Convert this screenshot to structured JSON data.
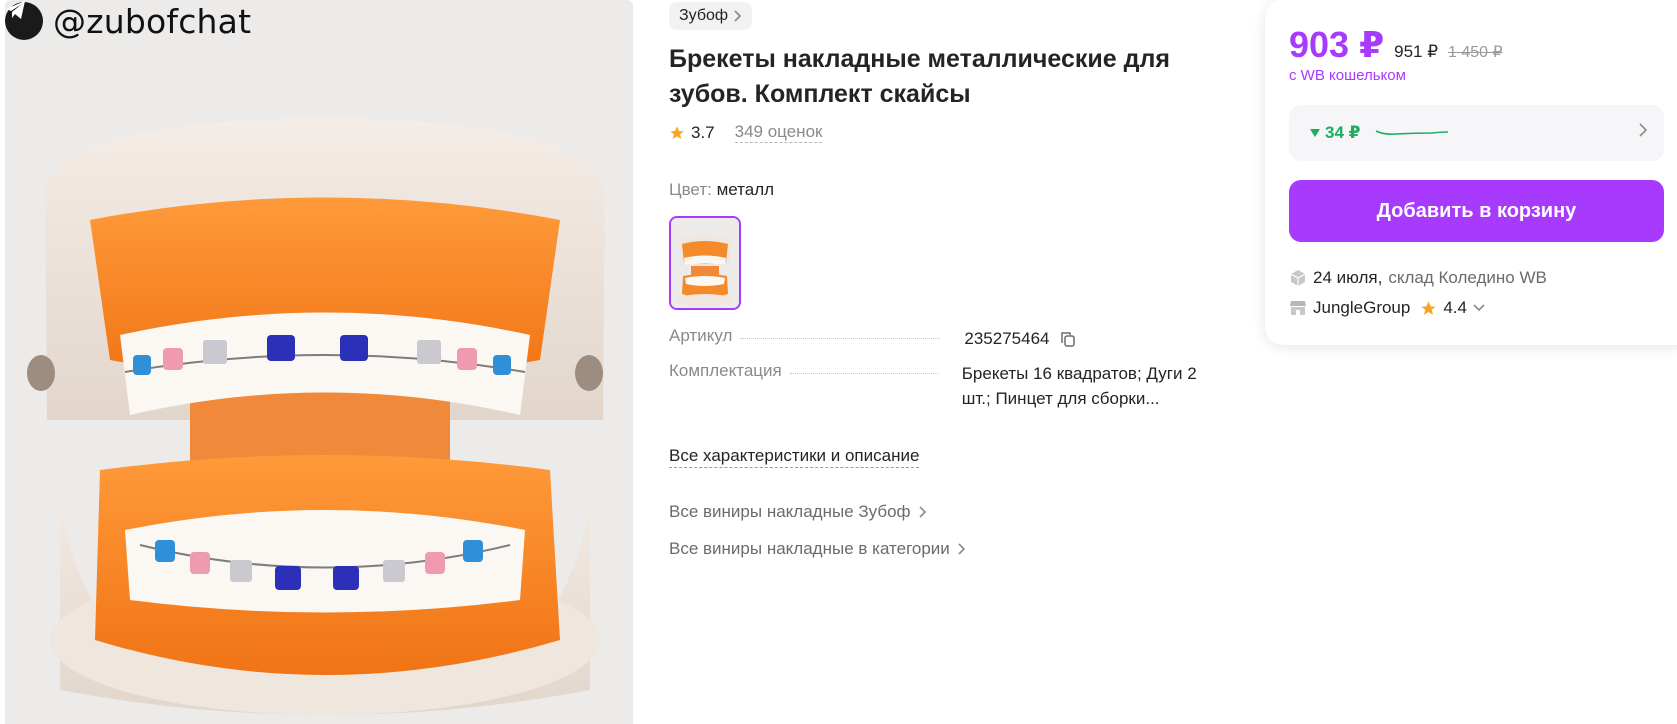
{
  "watermark": {
    "handle": "@zubofchat",
    "icon": "telegram-icon"
  },
  "brand": {
    "name": "Зубоф"
  },
  "product": {
    "title": "Брекеты накладные металлические для зубов. Комплект скайсы",
    "rating": "3.7",
    "reviews": "349 оценок",
    "color_label": "Цвет:",
    "color_value": "металл"
  },
  "specs": [
    {
      "label": "Артикул",
      "value": "235275464"
    },
    {
      "label": "Комплектация",
      "value": "Брекеты 16 квадратов; Дуги 2 шт.; Пинцет для сборки..."
    }
  ],
  "links": {
    "all_specs": "Все характеристики и описание",
    "brand_category": "Все виниры накладные Зубоф",
    "category": "Все виниры накладные в категории"
  },
  "price": {
    "current": "903 ₽",
    "regular": "951 ₽",
    "old": "1 450 ₽",
    "wallet_note": "с WB кошельком",
    "drop": "34 ₽"
  },
  "cart": {
    "label": "Добавить в корзину"
  },
  "delivery": {
    "date": "24 июля,",
    "warehouse": "склад Коледино WB"
  },
  "seller": {
    "name": "JungleGroup",
    "rating": "4.4"
  },
  "colors": {
    "accent": "#a73afd",
    "green": "#1fae5f",
    "star": "#f5a623"
  }
}
